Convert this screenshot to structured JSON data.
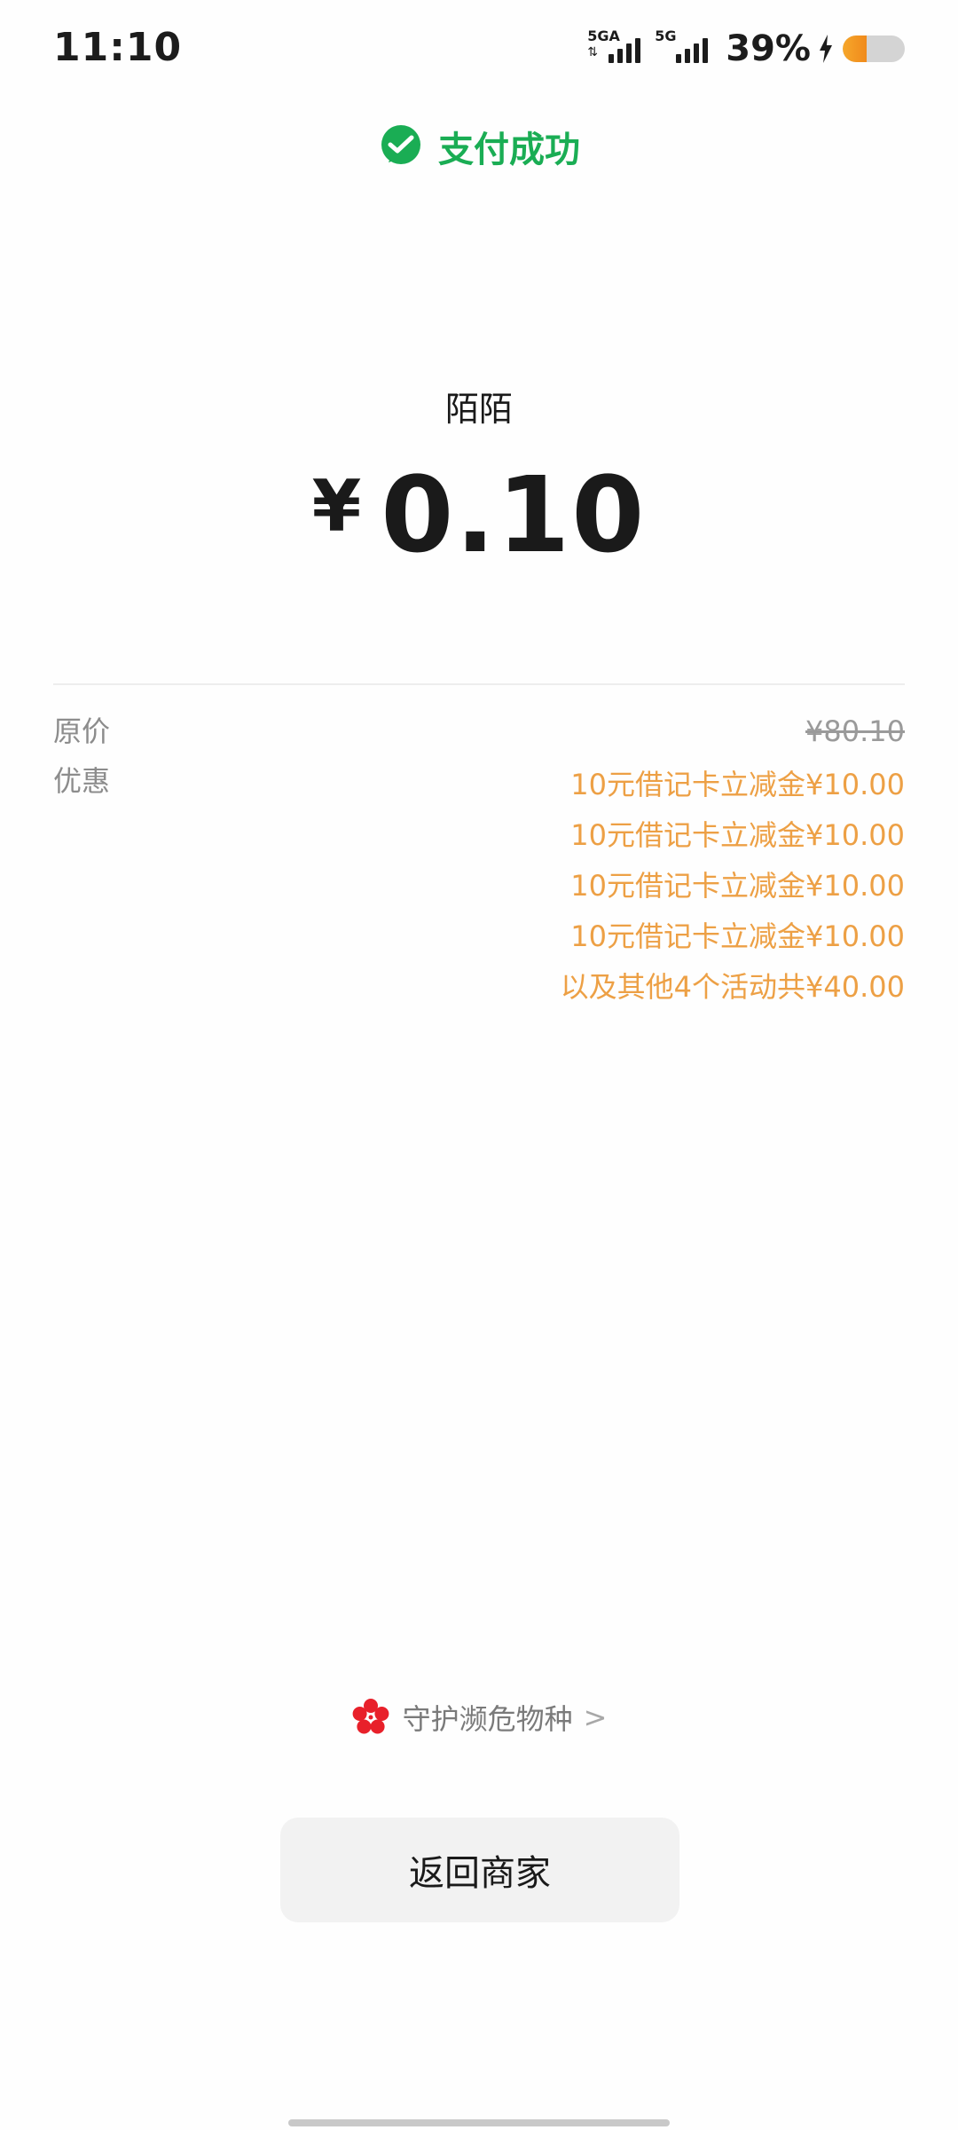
{
  "status_bar": {
    "time": "11:10",
    "sim1_label": "5GA",
    "sim2_label": "5G",
    "battery_percent": "39%",
    "battery_level": 0.39
  },
  "header": {
    "title": "支付成功",
    "icon": "wechat-pay-icon",
    "accent_color": "#1aad54"
  },
  "payment": {
    "merchant": "陌陌",
    "currency_symbol": "¥",
    "amount": "0.10"
  },
  "details": {
    "original_label": "原价",
    "original_value": "¥80.10",
    "discount_label": "优惠",
    "discount_color": "#eda045",
    "discounts": [
      "10元借记卡立减金¥10.00",
      "10元借记卡立减金¥10.00",
      "10元借记卡立减金¥10.00",
      "10元借记卡立减金¥10.00",
      "以及其他4个活动共¥40.00"
    ]
  },
  "protect": {
    "text": "守护濒危物种",
    "icon": "red-flower-icon",
    "chevron": ">"
  },
  "return_button": {
    "label": "返回商家"
  }
}
